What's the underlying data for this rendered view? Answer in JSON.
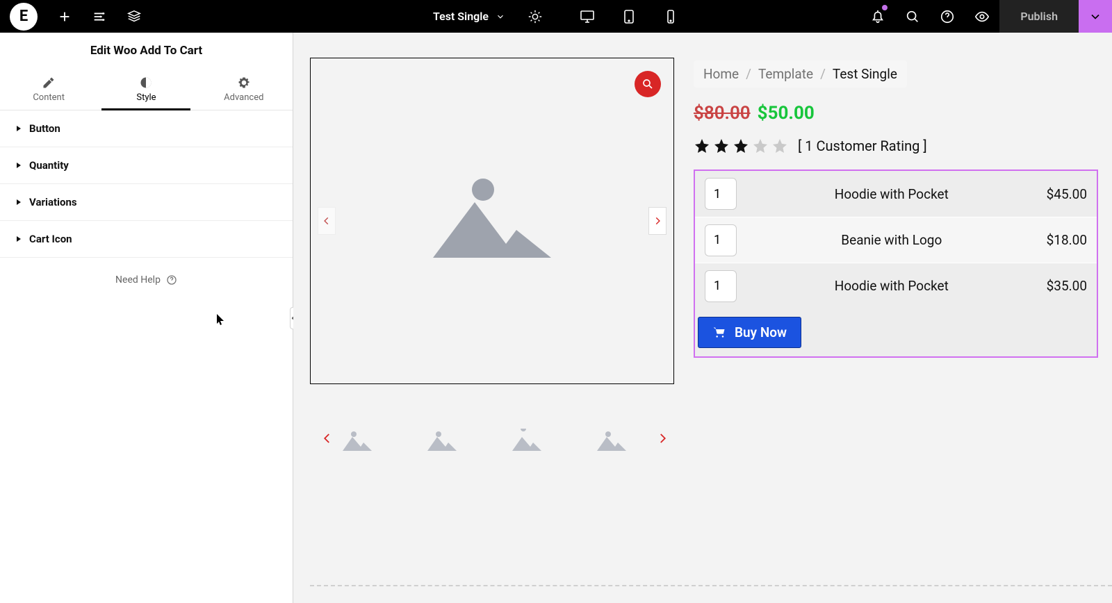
{
  "topbar": {
    "doc_name": "Test Single",
    "publish_label": "Publish"
  },
  "panel": {
    "title": "Edit Woo Add To Cart",
    "tabs": {
      "content": "Content",
      "style": "Style",
      "advanced": "Advanced"
    },
    "sections": [
      "Button",
      "Quantity",
      "Variations",
      "Cart Icon"
    ],
    "help": "Need Help"
  },
  "breadcrumbs": {
    "home": "Home",
    "template": "Template",
    "current": "Test Single"
  },
  "price": {
    "old": "$80.00",
    "new": "$50.00"
  },
  "rating": {
    "text": "[ 1 Customer Rating ]",
    "filled": 3,
    "total": 5
  },
  "cart": {
    "items": [
      {
        "qty": "1",
        "name": "Hoodie with Pocket",
        "price": "$45.00"
      },
      {
        "qty": "1",
        "name": "Beanie with Logo",
        "price": "$18.00"
      },
      {
        "qty": "1",
        "name": "Hoodie with Pocket",
        "price": "$35.00"
      }
    ],
    "buy_label": "Buy Now"
  }
}
